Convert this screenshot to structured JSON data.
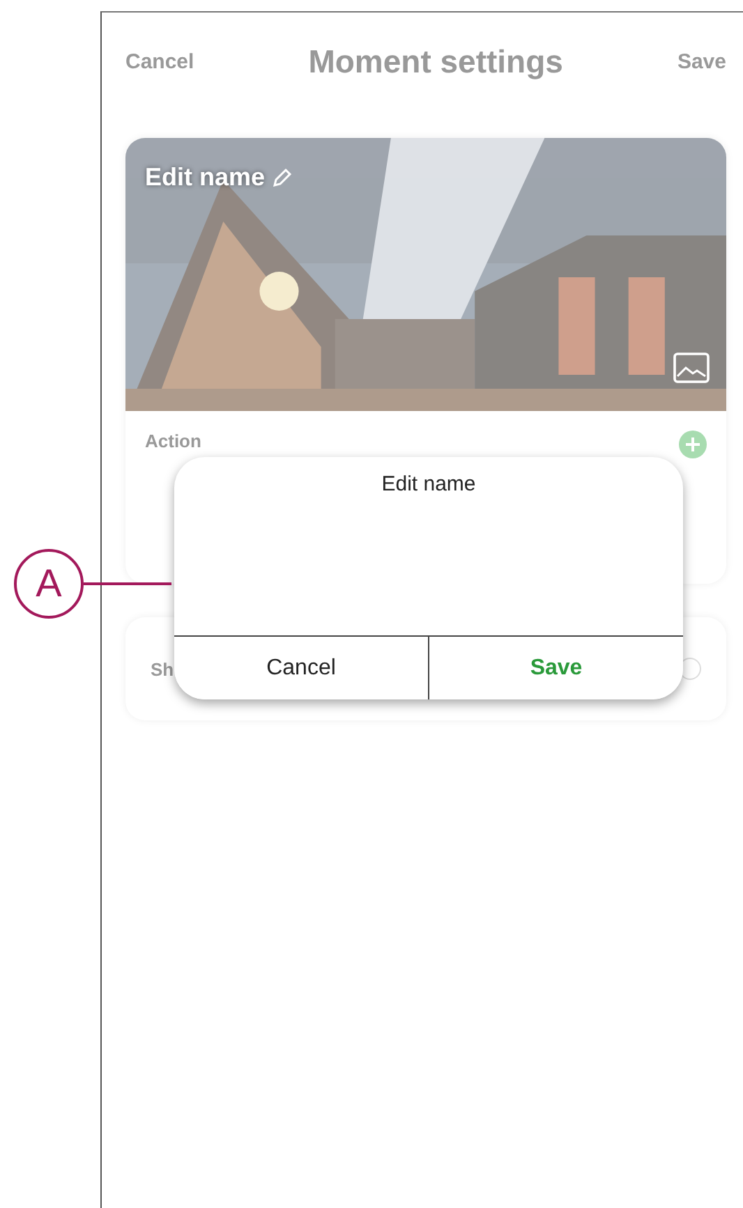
{
  "screen": {
    "header": {
      "cancel": "Cancel",
      "title": "Moment settings",
      "save": "Save"
    },
    "cover": {
      "name": "Edit name",
      "kind": "picture"
    },
    "action_card": {
      "label": "Action"
    },
    "second_card": {
      "label": "Sh",
      "on": false
    }
  },
  "dialog": {
    "title": "Edit name",
    "buttons": [
      {
        "label": "Cancel",
        "kind": "cancel"
      },
      {
        "label": "Save",
        "kind": "confirm"
      }
    ]
  },
  "callout": {
    "label": "A"
  }
}
